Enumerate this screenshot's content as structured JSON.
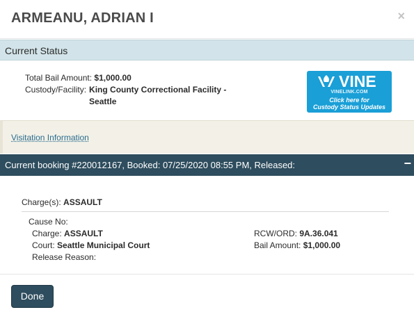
{
  "header": {
    "title": "ARMEANU, ADRIAN I",
    "close_icon": "close-icon"
  },
  "status": {
    "section_title": "Current Status",
    "bail_label": "Total Bail Amount:",
    "bail_value": "$1,000.00",
    "facility_label": "Custody/Facility:",
    "facility_value": "King County Correctional Facility - Seattle"
  },
  "vine": {
    "logo": "VINE",
    "site": "VINELINK.COM",
    "cta_line1": "Click here for",
    "cta_line2": "Custody Status Updates",
    "color": "#1a9fd7"
  },
  "visitation": {
    "link_text": "Visitation Information"
  },
  "booking": {
    "header_text": "Current booking #220012167, Booked: 07/25/2020 08:55 PM, Released:",
    "collapse_icon": "−",
    "charges_label": "Charge(s):",
    "charges_value": "ASSAULT",
    "cause_label": "Cause No:",
    "charge_label": "Charge:",
    "charge_value": "ASSAULT",
    "court_label": "Court:",
    "court_value": "Seattle Municipal Court",
    "release_label": "Release Reason:",
    "rcw_label": "RCW/ORD:",
    "rcw_value": "9A.36.041",
    "bail_label": "Bail Amount:",
    "bail_value": "$1,000.00"
  },
  "footer": {
    "done_label": "Done"
  },
  "colors": {
    "header_bar": "#2e4d5e",
    "status_bar": "#d2e4e9",
    "visitation_bg": "#f3f1e7"
  }
}
